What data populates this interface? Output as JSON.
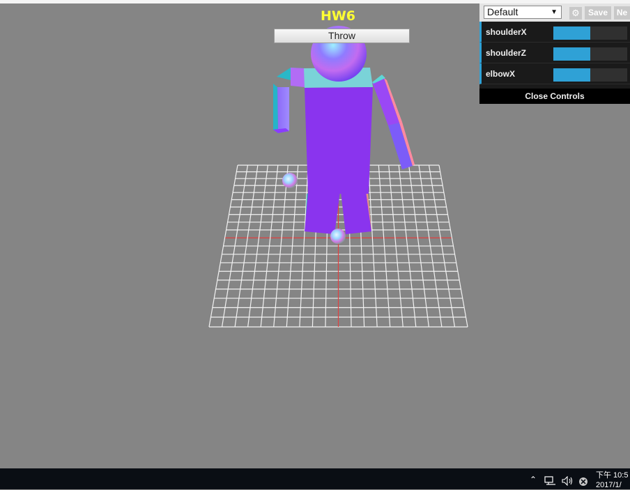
{
  "page": {
    "title": "HW6",
    "throw_button": "Throw",
    "top_text": "· · · · · · · · · ·"
  },
  "gui": {
    "preset": "Default",
    "save_label": "Save",
    "new_label": "Ne",
    "controls": [
      {
        "label": "shoulderX",
        "value": 0.5
      },
      {
        "label": "shoulderZ",
        "value": 0.5
      },
      {
        "label": "elbowX",
        "value": 0.5
      }
    ],
    "close_label": "Close Controls"
  },
  "taskbar": {
    "clock_time": "下午 10:5",
    "clock_date": "2017/1/",
    "icons": [
      "chevron-up-icon",
      "network-icon",
      "volume-icon",
      "close-circle-icon"
    ]
  },
  "colors": {
    "accent": "#2fa1d6",
    "title": "#ffff33",
    "background": "#858585",
    "body": "#8a2be2"
  }
}
